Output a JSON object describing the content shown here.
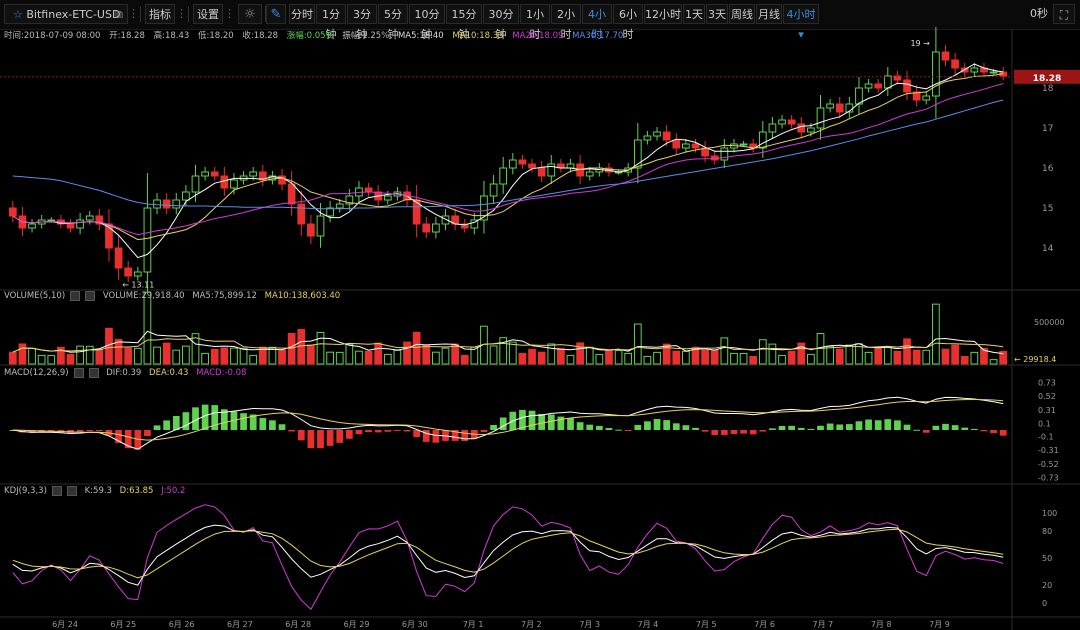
{
  "toolbar": {
    "symbol": "Bitfinex-ETC-USD",
    "indicators_label": "指标",
    "settings_label": "设置",
    "timeframes": [
      "分时",
      "1分钟",
      "3分钟",
      "5分钟",
      "10分钟",
      "15分钟",
      "30分钟",
      "1小时",
      "2小时",
      "4小时",
      "6小时",
      "12小时",
      "1天",
      "3天",
      "周线",
      "月线"
    ],
    "active_timeframe": "4小时",
    "timeframe_dropdown": "4小时",
    "countdown": "0秒"
  },
  "info": {
    "time": "时间:2018-07-09 08:00",
    "open": "开:18.28",
    "high": "高:18.43",
    "low": "低:18.20",
    "close": "收:18.28",
    "change": "涨幅:0.05%",
    "amplitude": "振幅:1.25%",
    "ma5": "MA5:18.40",
    "ma10": "MA10:18.33",
    "ma20": "MA20:18.09",
    "ma30": "MA30:17.70"
  },
  "volume_panel": {
    "title": "VOLUME(5,10)",
    "volume": "VOLUME:29,918.40",
    "ma5": "MA5:75,899.12",
    "ma10": "MA10:138,603.40",
    "current_label": "29918.4"
  },
  "macd_panel": {
    "title": "MACD(12,26,9)",
    "dif": "DIF:0.39",
    "dea": "DEA:0.43",
    "macd": "MACD:-0.08"
  },
  "kdj_panel": {
    "title": "KDJ(9,3,3)",
    "k": "K:59.3",
    "d": "D:63.85",
    "j": "J:50.2"
  },
  "colors": {
    "up": "#5fd34f",
    "down": "#e8312f",
    "ma5": "#ffffff",
    "ma10": "#e8d25a",
    "ma20": "#d23ad6",
    "ma30": "#5a8ee8",
    "price_tag": "#9b1515"
  },
  "chart_data": {
    "type": "candlestick",
    "price_axis_ticks": [
      18,
      17,
      16,
      15,
      14
    ],
    "price_range": [
      13.0,
      19.1
    ],
    "last_price_label": "18.28",
    "last_price": 18.28,
    "high_annotation": "19",
    "high_value": 19.0,
    "low_annotation": "13.11",
    "low_value": 13.11,
    "x_labels": [
      "6月 24",
      "6月 25",
      "6月 26",
      "6月 27",
      "6月 28",
      "6月 29",
      "6月 30",
      "7月 1",
      "7月 2",
      "7月 3",
      "7月 4",
      "7月 5",
      "7月 6",
      "7月 7",
      "7月 8",
      "7月 9"
    ],
    "volume_axis_label": "500000",
    "volume_axis_value": 500000,
    "volume_max": 700000,
    "macd_axis_ticks": [
      "0.73",
      "0.52",
      "0.31",
      "0.1",
      "-0.1",
      "-0.31",
      "-0.52",
      "-0.73"
    ],
    "macd_range": [
      -0.8,
      0.8
    ],
    "kdj_axis_ticks": [
      100,
      80,
      50,
      20,
      0
    ],
    "kdj_range": [
      -12,
      118
    ],
    "series": {
      "close": [
        14.8,
        14.5,
        14.6,
        14.7,
        14.7,
        14.6,
        14.5,
        14.7,
        14.8,
        14.6,
        14.0,
        13.5,
        13.3,
        13.4,
        15.0,
        15.2,
        15.0,
        15.2,
        15.4,
        15.8,
        15.9,
        15.8,
        15.5,
        15.7,
        15.8,
        15.9,
        15.7,
        15.8,
        15.6,
        15.1,
        14.6,
        14.3,
        14.8,
        15.0,
        15.1,
        15.3,
        15.5,
        15.4,
        15.2,
        15.3,
        15.4,
        15.2,
        14.6,
        14.4,
        14.6,
        14.8,
        14.6,
        14.5,
        14.7,
        15.3,
        15.6,
        16.0,
        16.2,
        16.1,
        16.0,
        15.8,
        16.1,
        16.0,
        16.1,
        15.8,
        15.9,
        16.0,
        15.9,
        15.9,
        16.0,
        16.7,
        16.8,
        16.9,
        16.7,
        16.5,
        16.6,
        16.5,
        16.3,
        16.2,
        16.5,
        16.6,
        16.6,
        16.5,
        16.9,
        17.1,
        17.2,
        17.1,
        16.9,
        17.0,
        17.5,
        17.6,
        17.4,
        17.6,
        18.0,
        18.1,
        18.0,
        18.3,
        18.2,
        17.9,
        17.7,
        17.8,
        18.9,
        18.7,
        18.5,
        18.4,
        18.5,
        18.4,
        18.4,
        18.3
      ],
      "open": [
        15.0,
        14.8,
        14.5,
        14.6,
        14.7,
        14.7,
        14.6,
        14.5,
        14.7,
        14.8,
        14.6,
        14.0,
        13.5,
        13.3,
        13.4,
        15.0,
        15.2,
        15.0,
        15.2,
        15.4,
        15.8,
        15.9,
        15.8,
        15.5,
        15.7,
        15.8,
        15.9,
        15.7,
        15.8,
        15.6,
        15.1,
        14.6,
        14.3,
        14.8,
        15.0,
        15.1,
        15.3,
        15.5,
        15.4,
        15.2,
        15.3,
        15.4,
        15.2,
        14.6,
        14.4,
        14.6,
        14.8,
        14.6,
        14.5,
        14.7,
        15.3,
        15.6,
        16.0,
        16.2,
        16.1,
        16.0,
        15.8,
        16.1,
        16.0,
        16.1,
        15.8,
        15.9,
        16.0,
        15.9,
        15.9,
        16.0,
        16.7,
        16.8,
        16.9,
        16.7,
        16.5,
        16.6,
        16.5,
        16.3,
        16.2,
        16.5,
        16.6,
        16.6,
        16.5,
        16.9,
        17.1,
        17.2,
        17.1,
        16.9,
        17.0,
        17.5,
        17.6,
        17.4,
        17.6,
        18.0,
        18.1,
        18.0,
        18.3,
        18.2,
        17.9,
        17.7,
        17.8,
        18.9,
        18.7,
        18.5,
        18.4,
        18.5,
        18.4,
        18.4
      ],
      "ma30": [
        15.8,
        15.78,
        15.76,
        15.74,
        15.72,
        15.68,
        15.62,
        15.56,
        15.5,
        15.44,
        15.36,
        15.28,
        15.2,
        15.14,
        15.1,
        15.08,
        15.07,
        15.06,
        15.05,
        15.05,
        15.05,
        15.04,
        15.03,
        15.03,
        15.02,
        15.02,
        15.02,
        15.02,
        15.02,
        15.01,
        15.0,
        14.99,
        14.98,
        14.98,
        14.98,
        14.99,
        15.0,
        15.0,
        15.01,
        15.02,
        15.03,
        15.03,
        15.03,
        15.03,
        15.04,
        15.05,
        15.06,
        15.06,
        15.07,
        15.09,
        15.12,
        15.16,
        15.2,
        15.24,
        15.28,
        15.32,
        15.36,
        15.4,
        15.44,
        15.48,
        15.52,
        15.55,
        15.58,
        15.6,
        15.63,
        15.67,
        15.71,
        15.75,
        15.79,
        15.83,
        15.87,
        15.91,
        15.95,
        15.99,
        16.03,
        16.07,
        16.11,
        16.15,
        16.19,
        16.23,
        16.28,
        16.33,
        16.38,
        16.43,
        16.49,
        16.55,
        16.61,
        16.67,
        16.73,
        16.8,
        16.86,
        16.92,
        16.98,
        17.04,
        17.1,
        17.15,
        17.22,
        17.29,
        17.36,
        17.43,
        17.5,
        17.57,
        17.64,
        17.7
      ]
    }
  }
}
